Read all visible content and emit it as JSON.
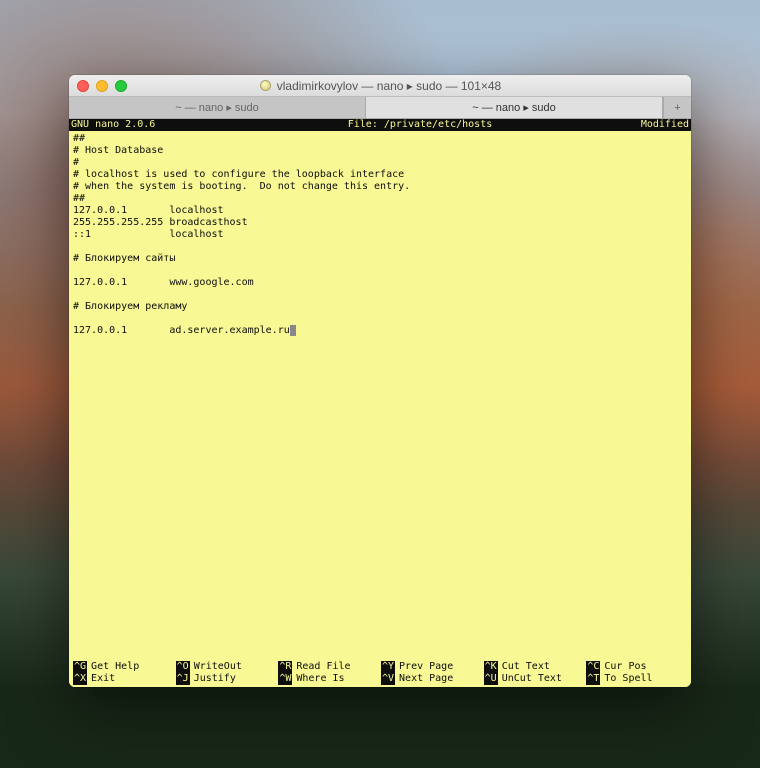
{
  "window": {
    "title": "vladimirkovylov — nano ▸ sudo — 101×48"
  },
  "tabs": {
    "0": {
      "label": "~ — nano ▸ sudo"
    },
    "1": {
      "label": "~ — nano ▸ sudo"
    },
    "new": "+"
  },
  "nano": {
    "version": "  GNU nano 2.0.6",
    "file": "File: /private/etc/hosts",
    "modified": "Modified",
    "body": "##\n# Host Database\n#\n# localhost is used to configure the loopback interface\n# when the system is booting.  Do not change this entry.\n##\n127.0.0.1       localhost\n255.255.255.255 broadcasthost\n::1             localhost\n\n# Блокируем сайты\n\n127.0.0.1       www.google.com\n\n# Блокируем рекламу\n\n127.0.0.1       ad.server.example.ru"
  },
  "shortcuts": {
    "getHelp": {
      "key": "^G",
      "label": "Get Help"
    },
    "writeOut": {
      "key": "^O",
      "label": "WriteOut"
    },
    "readFile": {
      "key": "^R",
      "label": "Read File"
    },
    "prevPage": {
      "key": "^Y",
      "label": "Prev Page"
    },
    "cutText": {
      "key": "^K",
      "label": "Cut Text"
    },
    "curPos": {
      "key": "^C",
      "label": "Cur Pos"
    },
    "exit": {
      "key": "^X",
      "label": "Exit"
    },
    "justify": {
      "key": "^J",
      "label": "Justify"
    },
    "whereIs": {
      "key": "^W",
      "label": "Where Is"
    },
    "nextPage": {
      "key": "^V",
      "label": "Next Page"
    },
    "uncutText": {
      "key": "^U",
      "label": "UnCut Text"
    },
    "toSpell": {
      "key": "^T",
      "label": "To Spell"
    }
  }
}
